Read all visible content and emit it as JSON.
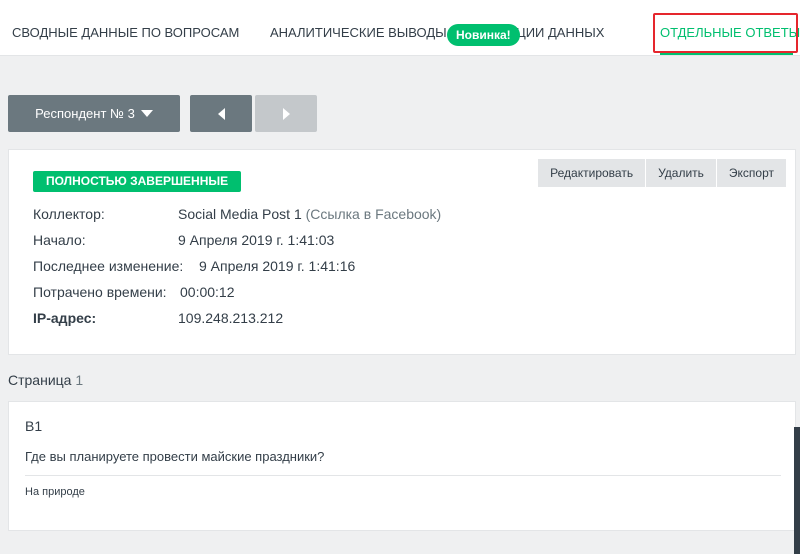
{
  "nav": {
    "tabs": [
      {
        "label": "СВОДНЫЕ ДАННЫЕ ПО ВОПРОСАМ"
      },
      {
        "label": "АНАЛИТИЧЕСКИЕ ВЫВОДЫ И ТЕНДЕНЦИИ ДАННЫХ"
      },
      {
        "label": "ОТДЕЛЬНЫЕ ОТВЕТЫ"
      }
    ],
    "new_badge": "Новинка!",
    "active_tab_color": "#00bf6f",
    "highlight_color": "#e5262d"
  },
  "controls": {
    "respondent_label": "Респондент № 3",
    "prev_icon": "chevron-left-icon",
    "next_icon": "chevron-right-icon"
  },
  "response": {
    "status": "ПОЛНОСТЬЮ ЗАВЕРШЕННЫЕ",
    "actions": [
      "Редактировать",
      "Удалить",
      "Экспорт"
    ],
    "collector_label": "Коллектор:",
    "collector_value": "Social Media Post 1",
    "collector_type": "(Ссылка в Facebook)",
    "start_label": "Начало:",
    "start_value": "9 Апреля 2019 г. 1:41:03",
    "modified_label": "Последнее изменение:",
    "modified_value": "9 Апреля 2019 г. 1:41:16",
    "spent_label": "Потрачено времени:",
    "spent_value": "00:00:12",
    "ip_label": "IP-адрес:",
    "ip_value": "109.248.213.212"
  },
  "page": {
    "label": "Страница",
    "number": "1"
  },
  "question": {
    "number": "В1",
    "text": "Где вы планируете провести майские праздники?",
    "answer": "На природе"
  }
}
